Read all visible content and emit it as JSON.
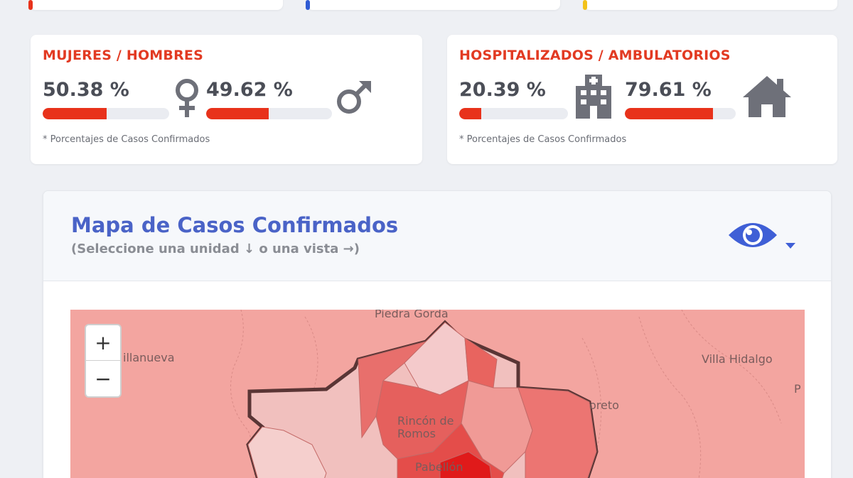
{
  "gender": {
    "title": "MUJERES / HOMBRES",
    "women_pct": "50.38 %",
    "women_fill": 0.5038,
    "men_pct": "49.62 %",
    "men_fill": 0.4962,
    "note": "* Porcentajes  de Casos Confirmados",
    "women_icon": "female-icon",
    "men_icon": "male-icon"
  },
  "hospital": {
    "title": "HOSPITALIZADOS / AMBULATORIOS",
    "hosp_pct": "20.39 %",
    "hosp_fill": 0.2039,
    "amb_pct": "79.61 %",
    "amb_fill": 0.7961,
    "note": "* Porcentajes  de Casos Confirmados",
    "hosp_icon": "hospital-icon",
    "amb_icon": "home-icon"
  },
  "map": {
    "title": "Mapa de Casos Confirmados",
    "subtitle": "(Seleccione una unidad ↓ o una vista →)",
    "view_icon": "eye-icon",
    "zoom_in": "+",
    "zoom_out": "−",
    "places": [
      "Piedra Gorda",
      "illanueva",
      "Villa Hidalgo",
      "oreto",
      "Rincón de Romos",
      "Pabellón",
      "P"
    ]
  },
  "colors": {
    "accent_red": "#e23a22",
    "bar_fill": "#e8321b",
    "title_blue": "#4a63c7",
    "icon_gray": "#6e7079"
  }
}
